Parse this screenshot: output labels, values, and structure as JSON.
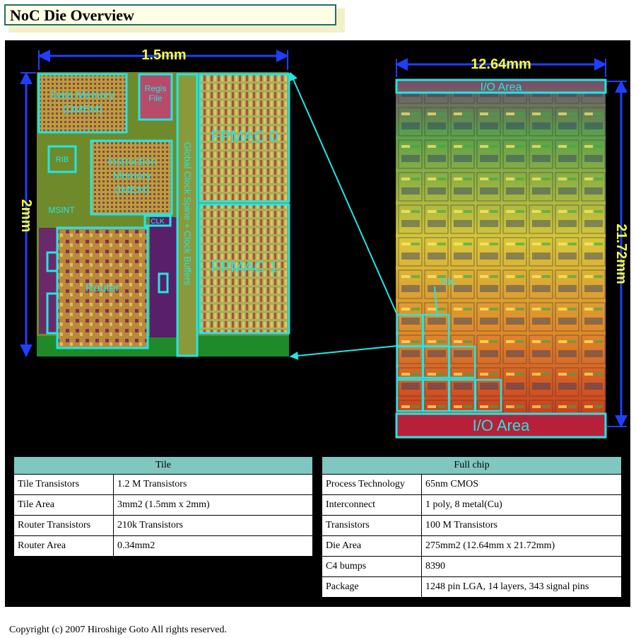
{
  "title": "NoC Die Overview",
  "tile_die": {
    "width_label": "1.5mm",
    "height_label": "2mm",
    "blocks": {
      "dmem_line1": "Data Memory",
      "dmem_line2": "(DMEM)",
      "regfile_line1": "Regis",
      "regfile_line2": "File",
      "imem_line1": "Instruction",
      "imem_line2": "Memory",
      "imem_line3": "(IMEM)",
      "rib": "RIB",
      "msint": "MSINT",
      "clk": "CLK",
      "router": "Router",
      "fpmac0": "FPMAC 0",
      "fpmac1": "FPMAC 1",
      "clock_spine": "Global Clock Spine + Clock Buffers"
    }
  },
  "full_die": {
    "width_label": "12.64mm",
    "height_label": "21.72mm",
    "io_top": "I/O Area",
    "io_bottom": "I/O Area",
    "tile_label": "Tile"
  },
  "tile_table": {
    "header": "Tile",
    "rows": [
      {
        "label": "Tile Transistors",
        "value": "1.2 M Transistors"
      },
      {
        "label": "Tile Area",
        "value": "3mm2 (1.5mm x 2mm)"
      },
      {
        "label": "Router Transistors",
        "value": "210k Transistors"
      },
      {
        "label": "Router Area",
        "value": "0.34mm2"
      }
    ]
  },
  "chip_table": {
    "header": "Full chip",
    "rows": [
      {
        "label": "Process Technology",
        "value": "65nm CMOS"
      },
      {
        "label": "Interconnect",
        "value": "1 poly, 8 metal(Cu)"
      },
      {
        "label": "Transistors",
        "value": "100 M Transistors"
      },
      {
        "label": "Die Area",
        "value": "275mm2 (12.64mm x 21.72mm)"
      },
      {
        "label": "C4 bumps",
        "value": "8390"
      },
      {
        "label": "Package",
        "value": "1248 pin LGA, 14 layers, 343 signal pins"
      }
    ]
  },
  "copyright": "Copyright (c) 2007 Hiroshige Goto All rights reserved.",
  "colors": {
    "background": "#000000",
    "highlight": "#22e6e6",
    "dimension": "#ffff33",
    "arrow": "#1f3fff",
    "table_header": "#7fc7c0",
    "die_green": "#5a8a2a"
  }
}
